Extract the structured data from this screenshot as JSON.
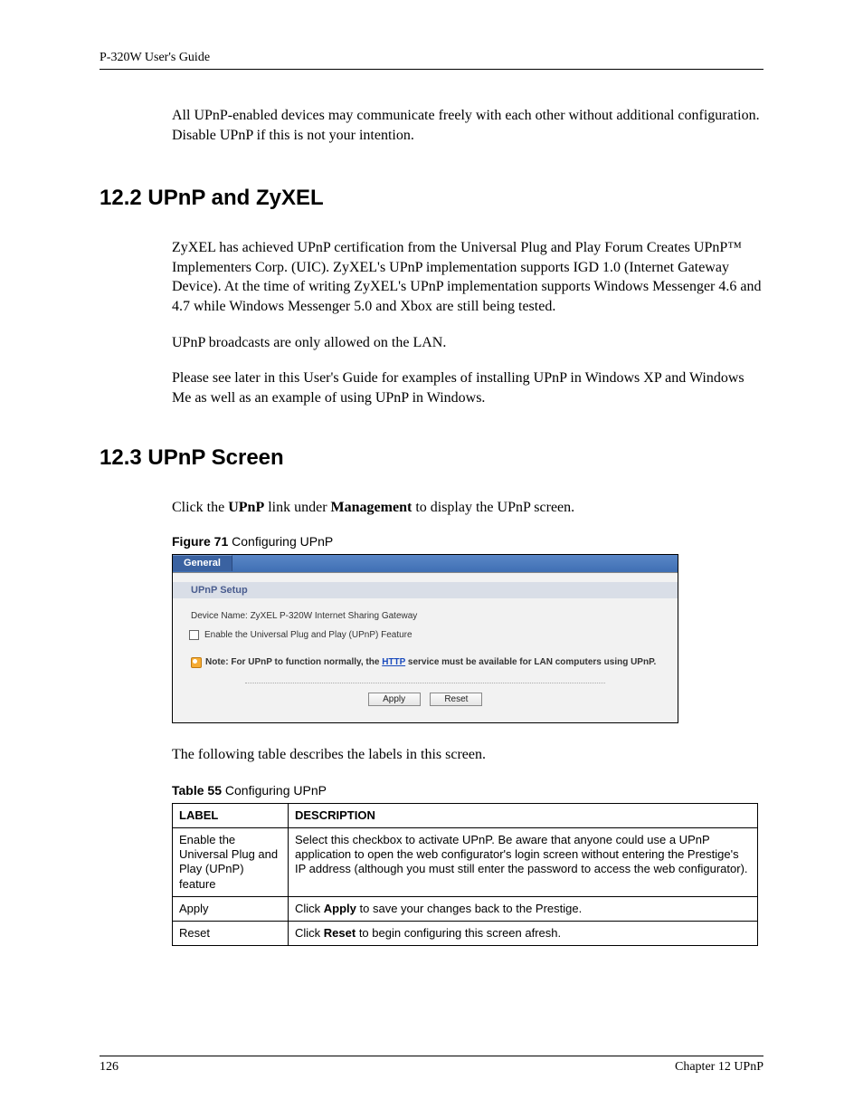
{
  "header": {
    "guide_title": "P-320W User's Guide"
  },
  "intro": {
    "text": "All UPnP-enabled devices may communicate freely with each other without additional configuration. Disable UPnP if this is not your intention."
  },
  "section_12_2": {
    "heading": "12.2  UPnP and ZyXEL",
    "p1": "ZyXEL has achieved UPnP certification from the Universal Plug and Play Forum Creates UPnP™ Implementers Corp. (UIC). ZyXEL's UPnP implementation supports IGD 1.0 (Internet Gateway Device). At the time of writing ZyXEL's UPnP implementation supports Windows Messenger 4.6 and 4.7 while Windows Messenger 5.0 and Xbox are still being tested.",
    "p2": "UPnP broadcasts are only allowed on the LAN.",
    "p3": "Please see later in this User's Guide for examples of installing UPnP in Windows XP and Windows Me as well as an example of using UPnP in Windows."
  },
  "section_12_3": {
    "heading": "12.3  UPnP Screen",
    "p1_pre": "Click the ",
    "p1_link1": "UPnP",
    "p1_mid": " link under ",
    "p1_link2": "Management",
    "p1_post": " to display the UPnP screen.",
    "figure_label": "Figure 71",
    "figure_title": "   Configuring UPnP"
  },
  "ui": {
    "tab_label": "General",
    "section_title": "UPnP Setup",
    "device_name": "Device Name: ZyXEL P-320W Internet Sharing Gateway",
    "enable_label": "Enable the Universal Plug and Play (UPnP) Feature",
    "note_pre": "Note: For UPnP to function normally, the ",
    "note_link": "HTTP",
    "note_post": " service must be available for LAN computers using UPnP.",
    "btn_apply": "Apply",
    "btn_reset": "Reset"
  },
  "after_figure": {
    "text": "The following table describes the labels in this screen."
  },
  "table": {
    "caption_label": "Table 55",
    "caption_title": "   Configuring UPnP",
    "header": {
      "c1": "LABEL",
      "c2": "DESCRIPTION"
    },
    "rows": [
      {
        "label": "Enable the Universal Plug and Play (UPnP) feature",
        "desc": "Select this checkbox to activate UPnP. Be aware that anyone could use a UPnP application to open the web configurator's login screen without entering the Prestige's IP address (although you must still enter the password to access the web configurator)."
      },
      {
        "label": "Apply",
        "desc_pre": "Click ",
        "desc_bold": "Apply",
        "desc_post": " to save your changes back to the Prestige."
      },
      {
        "label": "Reset",
        "desc_pre": "Click ",
        "desc_bold": "Reset",
        "desc_post": " to begin configuring this screen afresh."
      }
    ]
  },
  "footer": {
    "page": "126",
    "chapter": "Chapter 12 UPnP"
  }
}
